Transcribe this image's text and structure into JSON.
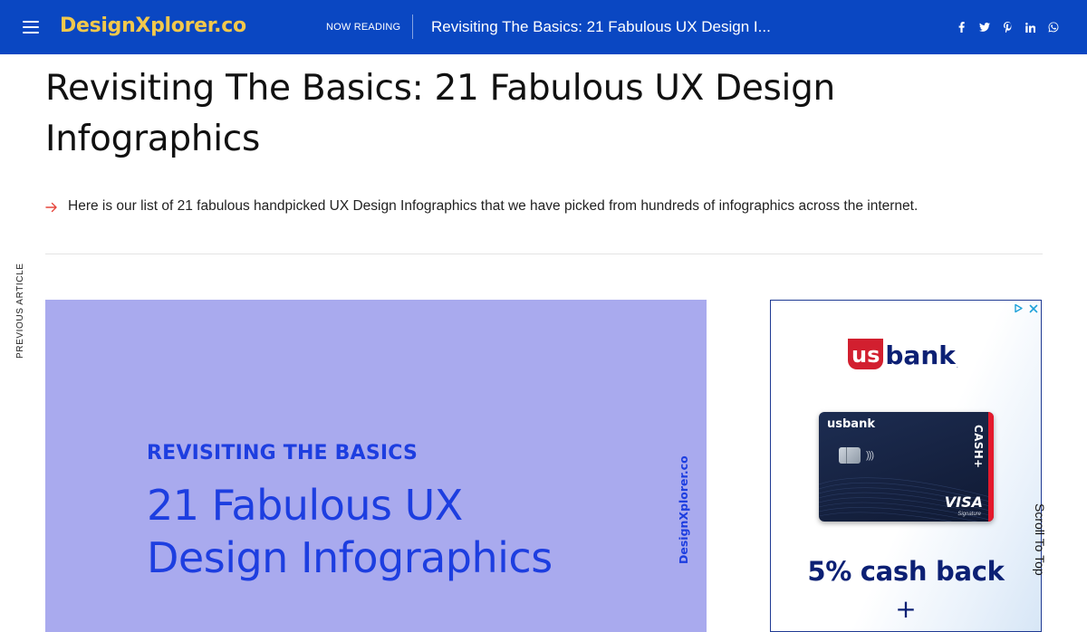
{
  "header": {
    "logo": "DesignXplorer.co",
    "now_reading_label": "NOW READING",
    "current_title": "Revisiting The Basics: 21 Fabulous UX Design I...",
    "socials": [
      "facebook-icon",
      "twitter-icon",
      "pinterest-icon",
      "linkedin-icon",
      "whatsapp-icon"
    ]
  },
  "article": {
    "title": "Revisiting The Basics: 21 Fabulous UX Design Infographics",
    "excerpt": "Here is our list of 21 fabulous handpicked UX Design Infographics that we have picked from hundreds of infographics across the internet."
  },
  "sidebar_left": {
    "previous_label": "PREVIOUS ARTICLE"
  },
  "featured_image": {
    "kicker": "REVISITING THE BASICS",
    "headline_line1": "21 Fabulous UX",
    "headline_line2": "Design Infographics",
    "side_text": "DesignXplorer.co",
    "background": "#a9aaee",
    "text_color": "#1d3ee0"
  },
  "ad": {
    "brand_us": "us",
    "brand_bank": "bank",
    "card_brand": "usbank",
    "card_product": "CASH+",
    "card_network": "VISA",
    "card_network_sub": "Signature",
    "offer": "5% cash back",
    "offer_plus": "+"
  },
  "scroll_top_label": "Scroll To Top",
  "colors": {
    "topbar": "#0a47c2",
    "logo": "#f2c84b",
    "accent_arrow": "#e6463c",
    "usbank_red": "#d21f2f",
    "usbank_navy": "#0c2074"
  }
}
